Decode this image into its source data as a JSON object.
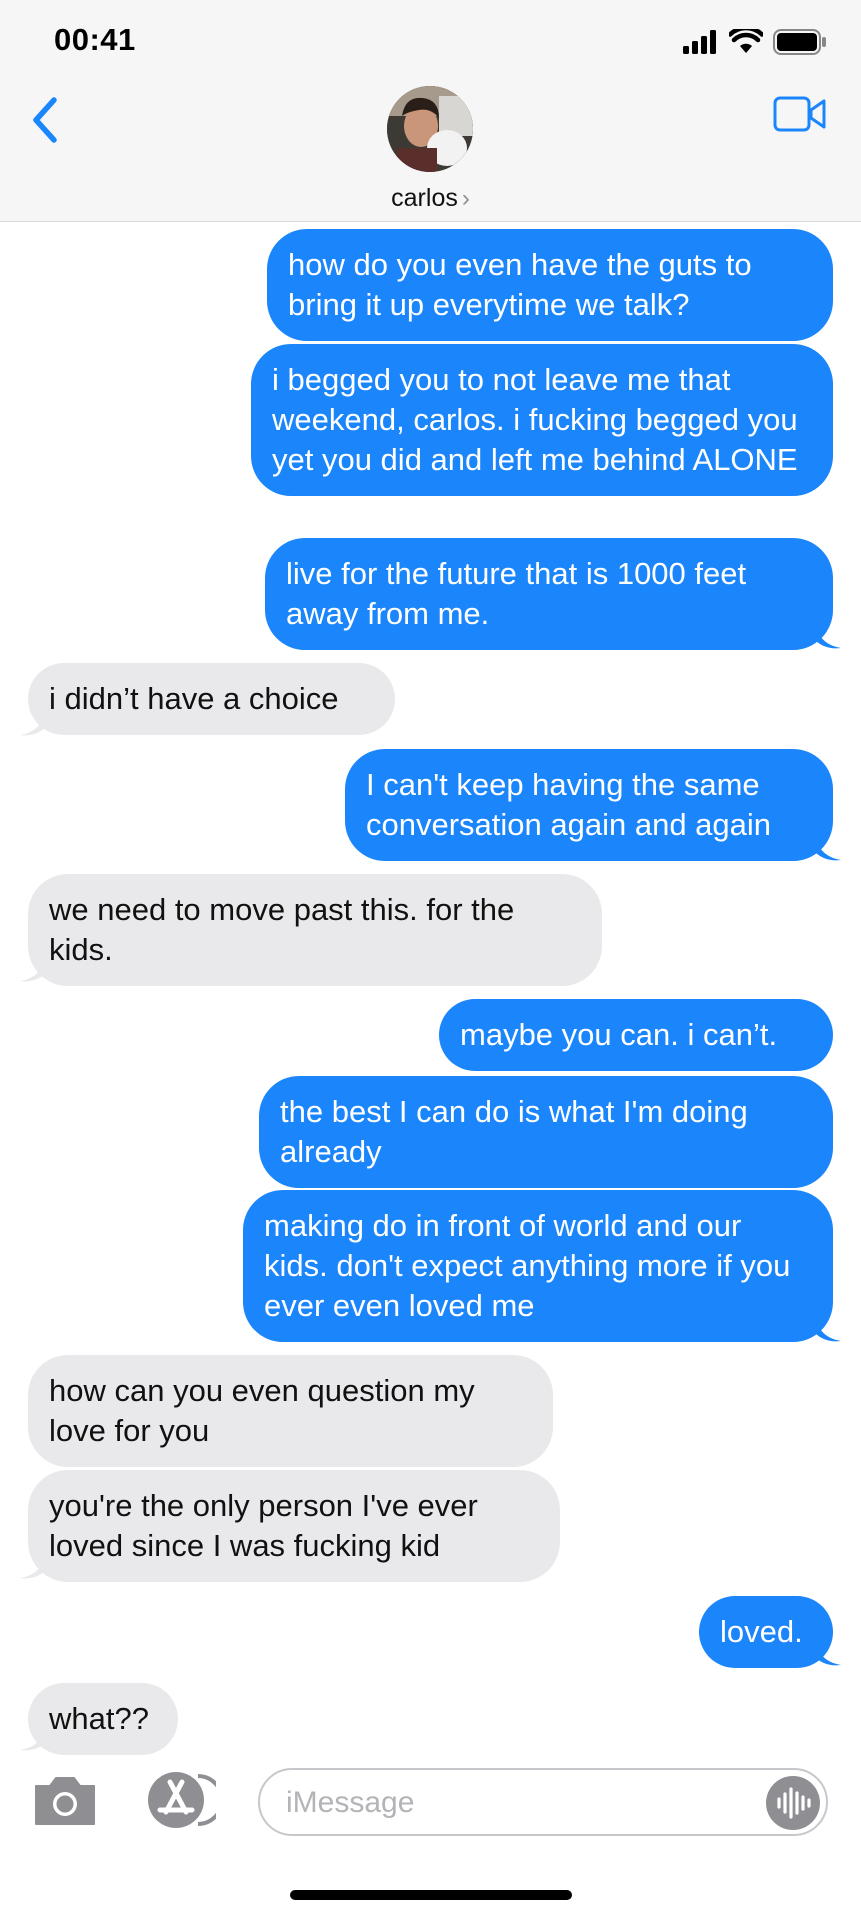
{
  "status_bar": {
    "time": "00:41",
    "icons": [
      "signal-icon",
      "wifi-icon",
      "battery-icon"
    ]
  },
  "header": {
    "contact_name": "carlos",
    "back_icon": "chevron-left-icon",
    "video_icon": "video-camera-icon",
    "accent_color": "#1b85fb"
  },
  "messages": [
    {
      "dir": "sent",
      "text": "how do you even have the guts to bring it up everytime we talk?"
    },
    {
      "dir": "sent",
      "text": "i begged you to not leave me that weekend, carlos. i fucking begged you yet you did and left me behind ALONE"
    },
    {
      "dir": "sent",
      "text": "live for the future that is 1000 feet away from me."
    },
    {
      "dir": "received",
      "text": "i didn’t have a choice"
    },
    {
      "dir": "sent",
      "text": "I can't keep having the same conversation again and again"
    },
    {
      "dir": "received",
      "text": "we need to move past this. for the kids."
    },
    {
      "dir": "sent",
      "text": "maybe you can. i can’t."
    },
    {
      "dir": "sent",
      "text": "the best I can do is what I'm doing already"
    },
    {
      "dir": "sent",
      "text": "making do in front of world and our kids. don't expect anything more if you ever even loved me"
    },
    {
      "dir": "received",
      "text": "how can you even question my love for you"
    },
    {
      "dir": "received",
      "text": "you're the only person I've ever loved since I was fucking kid"
    },
    {
      "dir": "sent",
      "text": "loved."
    },
    {
      "dir": "received",
      "text": "what??"
    }
  ],
  "composer": {
    "placeholder": "iMessage",
    "camera_icon": "camera-icon",
    "apps_icon": "app-store-icon",
    "audio_icon": "audio-waveform-icon"
  },
  "colors": {
    "sent_bubble": "#1b85fb",
    "received_bubble": "#e9e9eb"
  }
}
